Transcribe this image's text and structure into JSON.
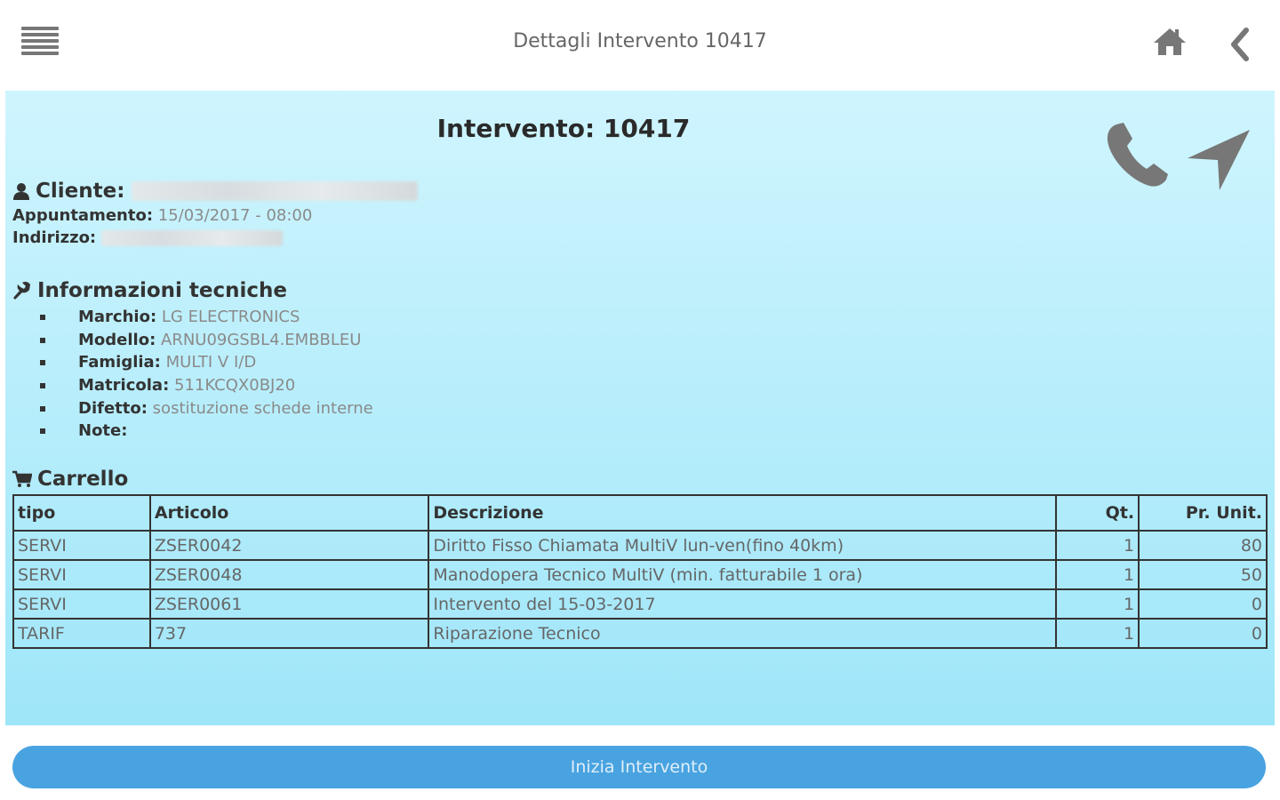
{
  "header": {
    "title": "Dettagli Intervento 10417",
    "menu_icon": "hamburger-menu-icon",
    "home_icon": "home-icon",
    "back_icon": "chevron-left-icon"
  },
  "intervento": {
    "title": "Intervento: 10417",
    "actions": {
      "phone_icon": "phone-icon",
      "navigate_icon": "location-arrow-icon"
    },
    "cliente_label": "Cliente:",
    "appuntamento_label": "Appuntamento:",
    "appuntamento_value": "15/03/2017 - 08:00",
    "indirizzo_label": "Indirizzo:"
  },
  "tech": {
    "title": "Informazioni tecniche",
    "items": [
      {
        "label": "Marchio:",
        "value": "LG ELECTRONICS"
      },
      {
        "label": "Modello:",
        "value": "ARNU09GSBL4.EMBBLEU"
      },
      {
        "label": "Famiglia:",
        "value": "MULTI V I/D"
      },
      {
        "label": "Matricola:",
        "value": "511KCQX0BJ20"
      },
      {
        "label": "Difetto:",
        "value": "sostituzione schede interne"
      },
      {
        "label": "Note:",
        "value": ""
      }
    ]
  },
  "cart": {
    "title": "Carrello",
    "headers": [
      "tipo",
      "Articolo",
      "Descrizione",
      "Qt.",
      "Pr. Unit."
    ],
    "rows": [
      [
        "SERVI",
        "ZSER0042",
        "Diritto Fisso Chiamata MultiV lun-ven(fino 40km)",
        "1",
        "80"
      ],
      [
        "SERVI",
        "ZSER0048",
        "Manodopera Tecnico MultiV (min. fatturabile 1 ora)",
        "1",
        "50"
      ],
      [
        "SERVI",
        "ZSER0061",
        "Intervento del 15-03-2017",
        "1",
        "0"
      ],
      [
        "TARIF",
        "737",
        "Riparazione Tecnico",
        "1",
        "0"
      ]
    ]
  },
  "start_button": {
    "label": "Inizia Intervento"
  },
  "colors": {
    "panel_top": "#cff5fe",
    "panel_bottom": "#9fe6f9",
    "button": "#49a3e0",
    "icon_gray": "#777777"
  }
}
